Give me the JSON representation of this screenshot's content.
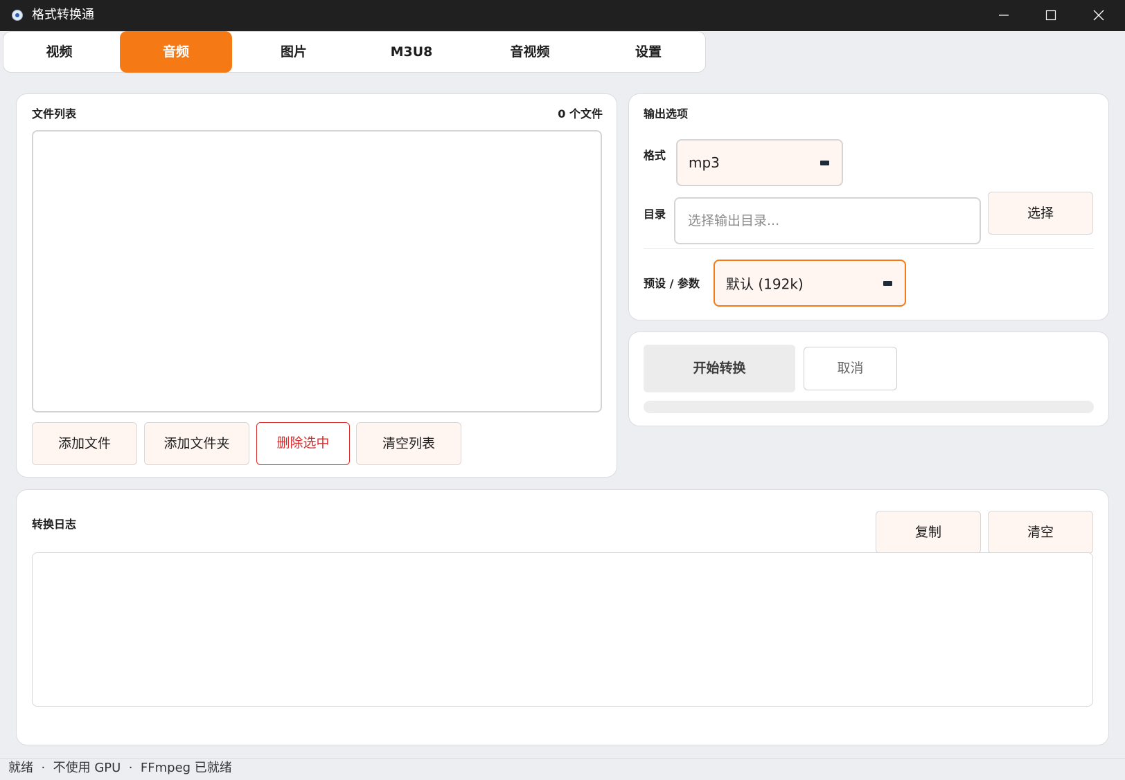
{
  "window": {
    "title": "格式转换通"
  },
  "tabs": [
    {
      "label": "视频"
    },
    {
      "label": "音频"
    },
    {
      "label": "图片"
    },
    {
      "label": "M3U8"
    },
    {
      "label": "音视频"
    },
    {
      "label": "设置"
    }
  ],
  "active_tab": "音频",
  "file_list": {
    "title": "文件列表",
    "count": "0 个文件",
    "buttons": {
      "add_file": "添加文件",
      "add_folder": "添加文件夹",
      "remove_selected": "删除选中",
      "clear_list": "清空列表"
    }
  },
  "output_options": {
    "title": "输出选项",
    "format_label": "格式",
    "format_value": "mp3",
    "dir_label": "目录",
    "dir_value": "",
    "dir_placeholder": "选择输出目录...",
    "dir_button": "选择",
    "preset_label": "预设 / 参数",
    "preset_value": "默认 (192k)"
  },
  "convert": {
    "start": "开始转换",
    "cancel": "取消",
    "progress": 0
  },
  "log": {
    "title": "转换日志",
    "copy": "复制",
    "clear": "清空",
    "content": ""
  },
  "status": {
    "text": "就绪  ·  不使用 GPU  ·  FFmpeg 已就绪"
  },
  "colors": {
    "accent": "#f57a16",
    "danger": "#d92c2c",
    "titlebar": "#202020",
    "background": "#eceef2"
  }
}
